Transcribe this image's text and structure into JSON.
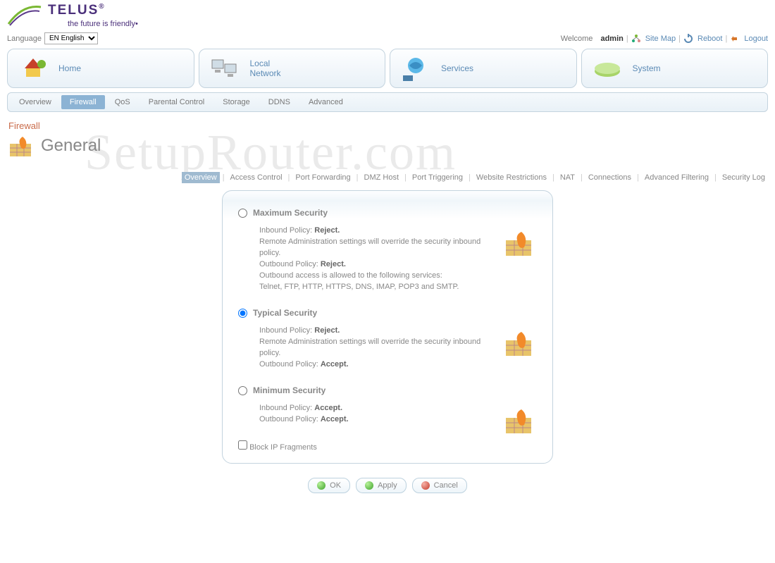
{
  "brand": {
    "name": "TELUS",
    "tagline": "the future is friendly•"
  },
  "language": {
    "label": "Language",
    "selected": "EN English"
  },
  "welcome": {
    "text": "Welcome",
    "user": "admin"
  },
  "topActions": {
    "sitemap": "Site Map",
    "reboot": "Reboot",
    "logout": "Logout"
  },
  "nav": [
    {
      "label": "Home"
    },
    {
      "label": "Local\nNetwork"
    },
    {
      "label": "Services"
    },
    {
      "label": "System"
    }
  ],
  "subnav": [
    "Overview",
    "Firewall",
    "QoS",
    "Parental Control",
    "Storage",
    "DDNS",
    "Advanced"
  ],
  "subnavActive": 1,
  "crumb": {
    "top": "Firewall",
    "title": "General"
  },
  "tabs": [
    "Overview",
    "Access Control",
    "Port Forwarding",
    "DMZ Host",
    "Port Triggering",
    "Website Restrictions",
    "NAT",
    "Connections",
    "Advanced Filtering",
    "Security Log"
  ],
  "tabsActive": 0,
  "securityLevels": [
    {
      "name": "Maximum Security",
      "checked": false,
      "lines": [
        {
          "label": "Inbound Policy:",
          "value": "Reject."
        },
        {
          "text": "Remote Administration settings will override the security inbound policy."
        },
        {
          "label": "Outbound Policy:",
          "value": "Reject."
        },
        {
          "text": "Outbound access is allowed to the following services:"
        },
        {
          "text": "Telnet, FTP, HTTP, HTTPS, DNS, IMAP, POP3 and SMTP."
        }
      ]
    },
    {
      "name": "Typical Security",
      "checked": true,
      "lines": [
        {
          "label": "Inbound Policy:",
          "value": "Reject."
        },
        {
          "text": "Remote Administration settings will override the security inbound policy."
        },
        {
          "label": "Outbound Policy:",
          "value": "Accept."
        }
      ]
    },
    {
      "name": "Minimum Security",
      "checked": false,
      "lines": [
        {
          "label": "Inbound Policy:",
          "value": "Accept."
        },
        {
          "label": "Outbound Policy:",
          "value": "Accept."
        }
      ]
    }
  ],
  "blockIp": "Block IP Fragments",
  "buttons": {
    "ok": "OK",
    "apply": "Apply",
    "cancel": "Cancel"
  },
  "watermark": "SetupRouter.com"
}
